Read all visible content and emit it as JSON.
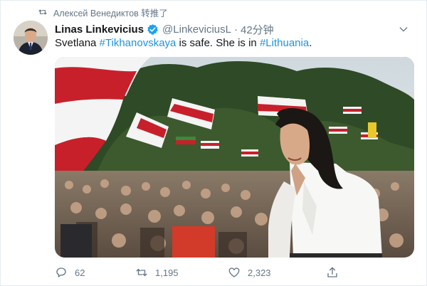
{
  "retweet_context": {
    "icon": "retweet-icon",
    "text": "Алексей Венедиктов 转推了"
  },
  "author": {
    "name": "Linas Linkevicius",
    "verified_icon": "verified-badge-icon",
    "handle": "@LinkeviciusL",
    "separator": "·",
    "time": "42分钟"
  },
  "tweet": {
    "text_1": "Svetlana ",
    "hashtag_1": "#Tikhanovskaya",
    "text_2": " is safe. She is in ",
    "hashtag_2": "#Lithuania",
    "text_3": "."
  },
  "actions": {
    "reply_count": "62",
    "retweet_count": "1,195",
    "like_count": "2,323",
    "share_icon": "share-icon"
  },
  "colors": {
    "link": "#1b95e0",
    "secondary_text": "#657786",
    "verified": "#1da1f2",
    "flag_white": "#f4f4f4",
    "flag_red": "#c8202b"
  }
}
